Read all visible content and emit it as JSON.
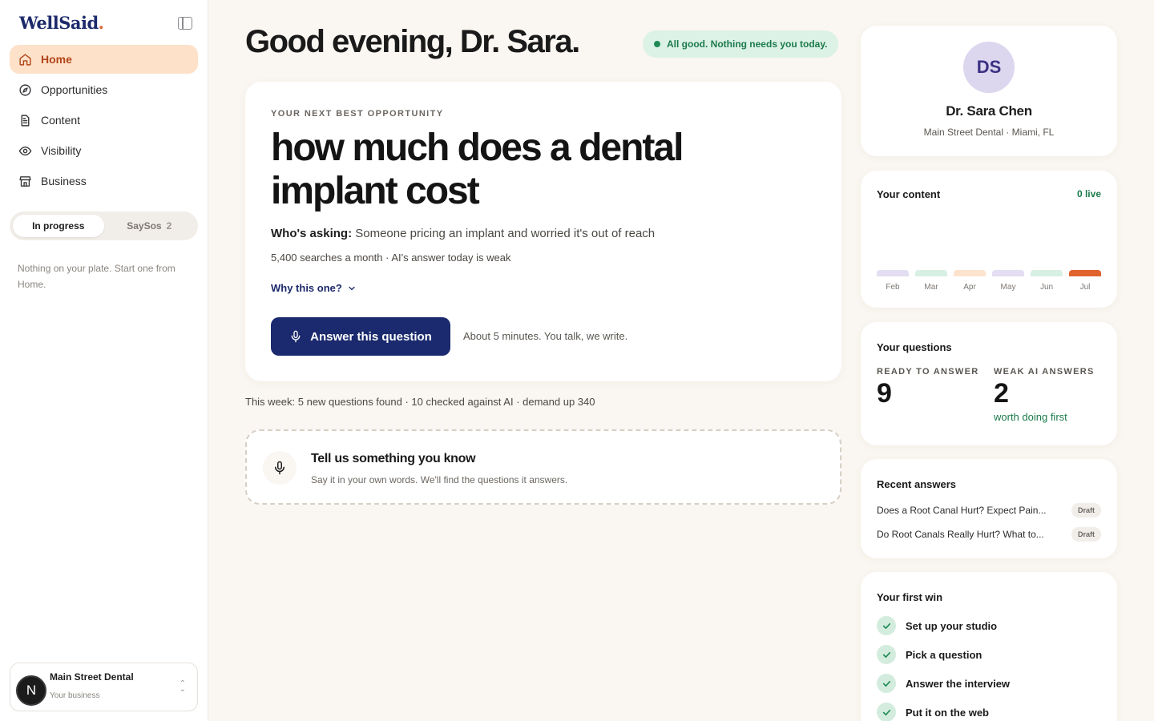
{
  "app": {
    "logo": "WellSaid",
    "logo_dot": "."
  },
  "sidebar": {
    "nav": [
      {
        "label": "Home",
        "icon": "home-icon",
        "active": true
      },
      {
        "label": "Opportunities",
        "icon": "compass-icon",
        "active": false
      },
      {
        "label": "Content",
        "icon": "document-icon",
        "active": false
      },
      {
        "label": "Visibility",
        "icon": "eye-icon",
        "active": false
      },
      {
        "label": "Business",
        "icon": "store-icon",
        "active": false
      }
    ],
    "segment": {
      "tab1": "In progress",
      "tab2": "SaySos",
      "tab2_count": "2"
    },
    "empty_note": "Nothing on your plate. Start one from Home.",
    "business": {
      "avatar": "N",
      "name": "Main Street Dental",
      "sub": "Your business"
    }
  },
  "main": {
    "greeting": "Good evening, Dr. Sara.",
    "status": "All good. Nothing needs you today.",
    "hero": {
      "eyebrow": "YOUR NEXT BEST OPPORTUNITY",
      "title": "how much does a dental implant cost",
      "who_label": "Who's asking:",
      "who_text": "Someone pricing an implant and worried it's out of reach",
      "stats": "5,400 searches a month · AI's answer today is weak",
      "why": "Why this one?",
      "cta": "Answer this question",
      "cta_note": "About 5 minutes. You talk, we write."
    },
    "week": "This week: 5 new questions found · 10 checked against AI · demand up 340",
    "tell": {
      "title": "Tell us something you know",
      "sub": "Say it in your own words. We'll find the questions it answers."
    }
  },
  "profile": {
    "initials": "DS",
    "name": "Dr. Sara Chen",
    "location": "Main Street Dental · Miami, FL"
  },
  "content_card": {
    "title": "Your content",
    "live": "0 live",
    "months": [
      {
        "label": "Feb",
        "color": "#e3def2"
      },
      {
        "label": "Mar",
        "color": "#d8efe3"
      },
      {
        "label": "Apr",
        "color": "#fbe3cd"
      },
      {
        "label": "May",
        "color": "#e3def2"
      },
      {
        "label": "Jun",
        "color": "#d8efe3"
      },
      {
        "label": "Jul",
        "color": "#e0632e"
      }
    ]
  },
  "questions": {
    "title": "Your questions",
    "ready_label": "READY TO ANSWER",
    "ready_value": "9",
    "weak_label": "WEAK AI ANSWERS",
    "weak_value": "2",
    "weak_note": "worth doing first"
  },
  "recent": {
    "title": "Recent answers",
    "items": [
      {
        "title": "Does a Root Canal Hurt? Expect Pain...",
        "badge": "Draft"
      },
      {
        "title": "Do Root Canals Really Hurt? What to...",
        "badge": "Draft"
      }
    ]
  },
  "first_win": {
    "title": "Your first win",
    "steps": [
      "Set up your studio",
      "Pick a question",
      "Answer the interview",
      "Put it on the web"
    ]
  }
}
